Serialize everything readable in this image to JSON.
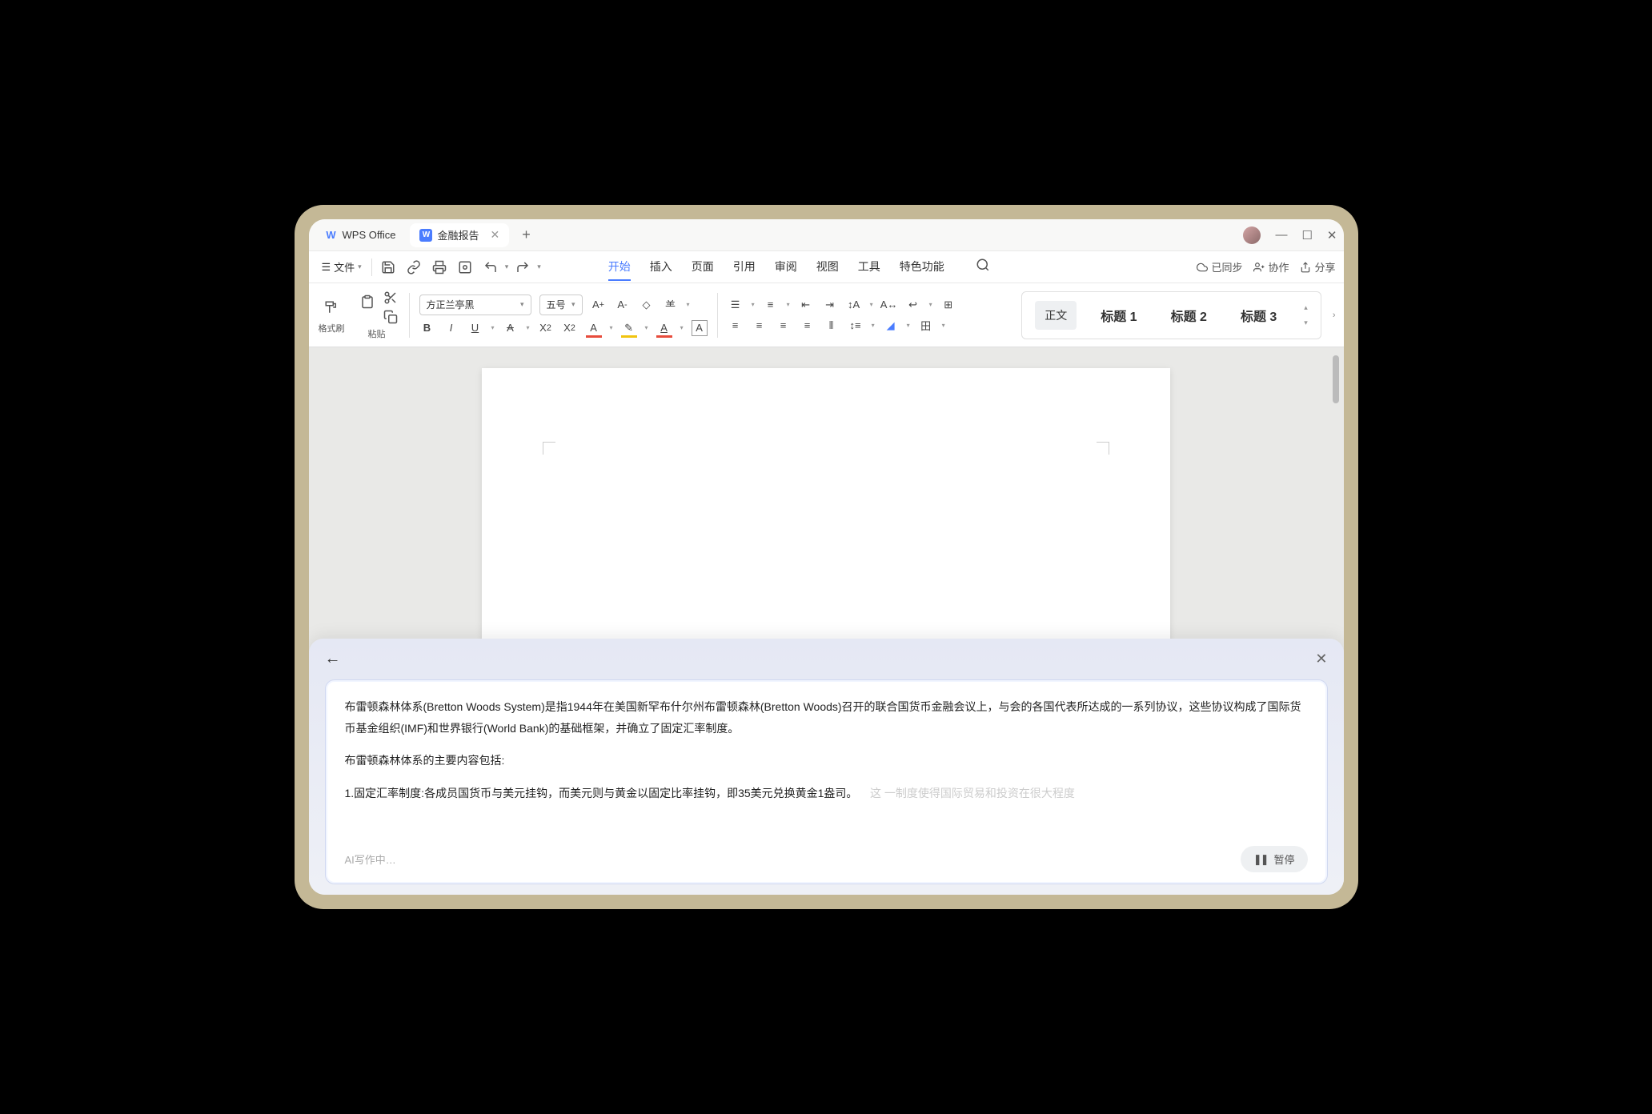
{
  "app": {
    "name": "WPS Office"
  },
  "tabs": {
    "doc_tab": "金融报告"
  },
  "menubar": {
    "file": "文件",
    "items": [
      "开始",
      "插入",
      "页面",
      "引用",
      "审阅",
      "视图",
      "工具",
      "特色功能"
    ],
    "right": {
      "sync": "已同步",
      "collab": "协作",
      "share": "分享"
    }
  },
  "toolbar": {
    "format_paint": "格式刷",
    "paste": "粘贴",
    "font_name": "方正兰亭黑",
    "font_size": "五号"
  },
  "styles": {
    "normal": "正文",
    "h1": "标题 1",
    "h2": "标题 2",
    "h3": "标题 3"
  },
  "ai_panel": {
    "paragraph1": "布雷顿森林体系(Bretton Woods System)是指1944年在美国新罕布什尔州布雷顿森林(Bretton Woods)召开的联合国货币金融会议上，与会的各国代表所达成的一系列协议，这些协议构成了国际货币基金组织(IMF)和世界银行(World Bank)的基础框架，并确立了固定汇率制度。",
    "paragraph2": "布雷顿森林体系的主要内容包括:",
    "paragraph3_main": "1.固定汇率制度:各成员国货币与美元挂钩，而美元则与黄金以固定比率挂钩，即35美元兑换黄金1盎司。",
    "paragraph3_faded": "这 一制度使得国际贸易和投资在很大程度",
    "status": "AI写作中…",
    "stop": "暂停"
  }
}
